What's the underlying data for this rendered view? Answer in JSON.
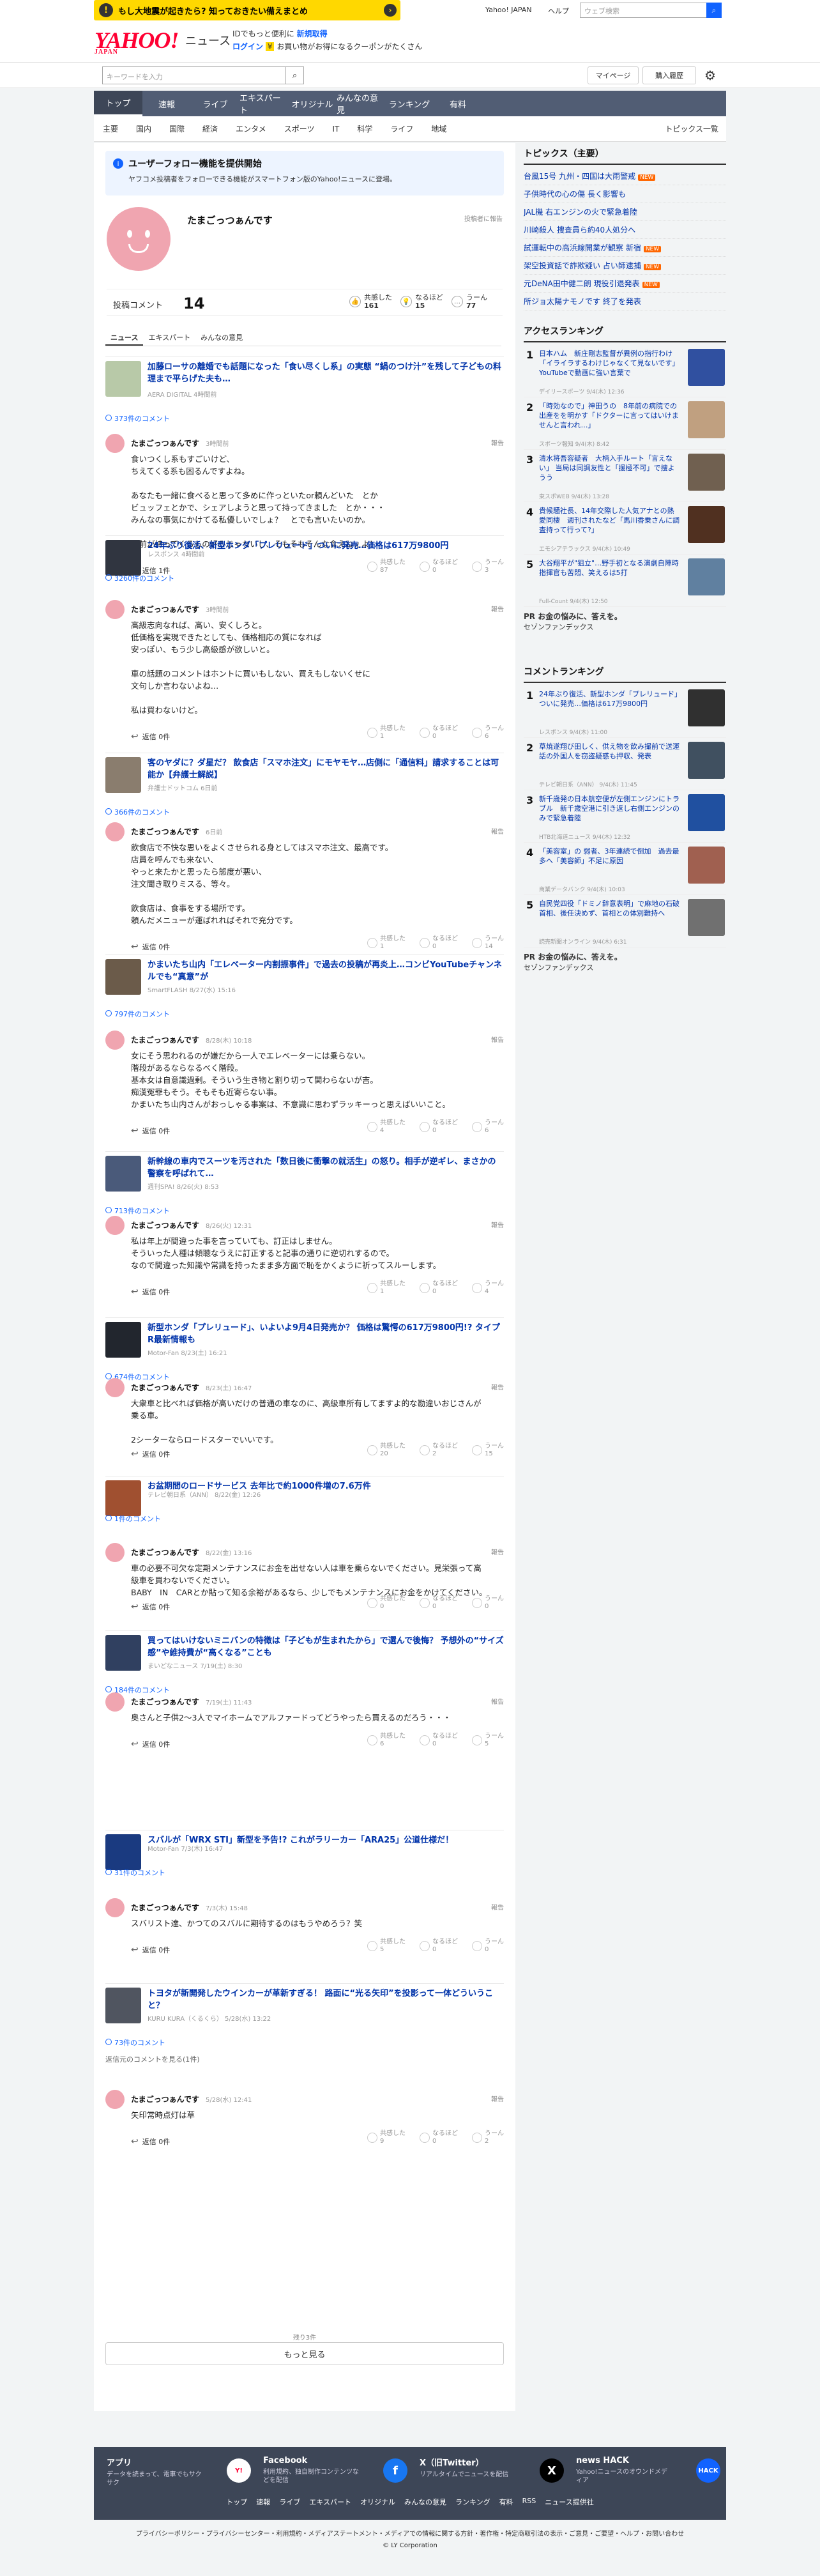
{
  "topbar": {
    "banner": "もし大地震が起きたら? 知っておきたい備えまとめ",
    "yjapan": "Yahoo! JAPAN",
    "help": "ヘルプ",
    "search_placeholder": "ウェブ検索",
    "search_btn": "🔍"
  },
  "header": {
    "logo": "YAHOO!",
    "logo_sub": "JAPAN",
    "brand": "ニュース",
    "id_text": "IDでもっと便利に",
    "id_link": "新規取得",
    "login": "ログイン",
    "coupon": "お買い物がお得になるクーポンがたくさん"
  },
  "subbar": {
    "keyword_placeholder": "キーワードを入力",
    "mypage": "マイページ",
    "purchased": "購入履歴"
  },
  "nav": [
    "トップ",
    "速報",
    "ライブ",
    "エキスパート",
    "オリジナル",
    "みんなの意見",
    "ランキング",
    "有料"
  ],
  "categories": [
    "主要",
    "国内",
    "国際",
    "経済",
    "エンタメ",
    "スポーツ",
    "IT",
    "科学",
    "ライフ",
    "地域"
  ],
  "all_topics": "トピックス一覧",
  "notice": {
    "title": "ユーザーフォロー機能を提供開始",
    "desc": "ヤフコメ投稿者をフォローできる機能がスマートフォン版のYahoo!ニュースに登場。"
  },
  "profile": {
    "name": "たまごっつぁんです",
    "report": "投稿者に報告",
    "posts_label": "投稿コメント",
    "posts": "14",
    "kyokan_label": "共感した",
    "kyokan": "161",
    "naruhodo_label": "なるほど",
    "naruhodo": "15",
    "uun_label": "うーん",
    "uun": "77"
  },
  "tabs": [
    "ニュース",
    "エキスパート",
    "みんなの意見"
  ],
  "articles": [
    {
      "title": "加藤ローサの離婚でも話題になった「食い尽くし系」の実態 “鍋のつけ汁”を残して子どもの料理まで平らげた夫も…",
      "src": "AERA DIGITAL 4時間前",
      "count": "373件のコメント",
      "date": "3時間前",
      "body": "食いつくし系もすごいけど、\nちえてくる系も困るんですよね。\n\nあなたも一緒に食べると思って多めに作っといたor頼んどいた　とか\nビュッフェとかで、シェアしようと思って持ってきました　とか・・・\nみんなの事気にかけてる私優しいでしょ？　とでも言いたいのか。\n\nお前が持ってくるもの好みじゃないし、そもそもそんな食えねぇよ！",
      "rep": "返信 1件",
      "k": "87",
      "n": "0",
      "u": "3"
    },
    {
      "title": "24年ぶり復活、新型ホンダ「プレリュード」ついに発売…価格は617万9800円",
      "src": "レスポンス 4時間前",
      "count": "3260件のコメント",
      "date": "3時間前",
      "body": "高級志向なれば、高い、安くしろと。\n低価格を実現できたとしても、価格相応の質になれば\n安っぽい、もう少し高級感が欲しいと。\n\n車の話題のコメントはホントに買いもしない、買えもしないくせに\n文句しか言わないよね…\n\n私は買わないけど。",
      "rep": "返信 0件",
      "k": "1",
      "n": "0",
      "u": "6"
    },
    {
      "title": "客のヤダに？ダ星だ？ 飲食店「スマホ注文」にモヤモヤ…店側に「通信料」請求することは可能か【弁護士解説】",
      "src": "弁護士ドットコム 6日前",
      "count": "366件のコメント",
      "date": "6日前",
      "body": "飲食店で不快な思いをよくさせられる身としてはスマホ注文、最高です。\n店員を呼んでも来ない、\nやっと来たかと思ったら態度が悪い、\n注文聞き取りミスる、等々。\n\n飲食店は、食事をする場所です。\n頼んだメニューが運ばれればそれで充分です。",
      "rep": "返信 0件",
      "k": "1",
      "n": "0",
      "u": "14"
    },
    {
      "title": "かまいたち山内「エレベーター内割振事件」で過去の投稿が再炎上…コンビYouTubeチャンネルでも“真意”が",
      "src": "SmartFLASH 8/27(水) 15:16",
      "count": "797件のコメント",
      "date": "8/28(木) 10:18",
      "body": "女にそう思われるのが嫌だから一人でエレベーターには乗らない。\n階段があるならなるべく階段。\n基本女は自意識過剰。そういう生き物と割り切って関わらないが吉。\n痴漢冤罪もそう。そもそも近寄らない事。\nかまいたち山内さんがおっしゃる事案は、不意識に思わずラッキーっと思えばいいこと。",
      "rep": "返信 0件",
      "k": "4",
      "n": "0",
      "u": "6"
    },
    {
      "title": "新幹線の車内でスーツを汚された「数日後に衝撃の就活生」の怒り。相手が逆ギレ、まさかの警察を呼ばれて…",
      "src": "週刊SPA! 8/26(火) 8:53",
      "count": "713件のコメント",
      "date": "8/26(火) 12:31",
      "body": "私は年上が間違った事を言っていても、訂正はしません。\nそういった人種は傾聴なうえに訂正すると記事の通りに逆切れするので。\nなので間違った知識や常識を持ったまま多方面で恥をかくように祈ってスルーします。",
      "rep": "返信 0件",
      "k": "1",
      "n": "0",
      "u": "4"
    },
    {
      "title": "新型ホンダ「プレリュード」、いよいよ9月4日発売か？ 価格は驚愕の617万9800円!? タイプR最新情報も",
      "src": "Motor-Fan 8/23(土) 16:21",
      "count": "674件のコメント",
      "date": "8/23(土) 16:47",
      "body": "大衆車と比べれば価格が高いだけの普通の車なのに、高級車所有してますよ的な勘違いおじさんが乗る車。\n\n2シーターならロードスターでいいです。",
      "rep": "返信 0件",
      "k": "20",
      "n": "2",
      "u": "15"
    },
    {
      "title": "お盆期間のロードサービス 去年比で約1000件増の7.6万件",
      "src": "テレビ朝日系（ANN） 8/22(金) 12:26",
      "count": "1件のコメント",
      "date": "8/22(金) 13:16",
      "body": "車の必要不可欠な定期メンテナンスにお金を出せない人は車を乗らないでください。見栄張って高級車を買わないでください。\nBABY　IN　CARとか貼って知る余裕があるなら、少しでもメンテナンスにお金をかけてください。",
      "rep": "返信 0件",
      "k": "0",
      "n": "0",
      "u": "0"
    },
    {
      "title": "買ってはいけないミニバンの特徴は「子どもが生まれたから」で選んで後悔？ 予想外の“サイズ感”や維持費が“高くなる”ことも",
      "src": "まいどなニュース 7/19(土) 8:30",
      "count": "184件のコメント",
      "date": "7/19(土) 11:43",
      "body": "奥さんと子供2〜3人でマイホームでアルファードってどうやったら買えるのだろう・・・",
      "rep": "返信 0件",
      "k": "6",
      "n": "0",
      "u": "5"
    },
    {
      "title": "スバルが「WRX STI」新型を予告!? これがラリーカー「ARA25」公道仕様だ！",
      "src": "Motor-Fan 7/3(木) 16:47",
      "count": "31件のコメント",
      "date": "7/3(木) 15:48",
      "body": "スバリスト達、かつてのスバルに期待するのはもうやめろう？笑",
      "rep": "返信 0件",
      "k": "5",
      "n": "0",
      "u": "0"
    },
    {
      "title": "トヨタが新開発したウインカーが革新すぎる！ 路面に“光る矢印”を投影って一体どういうこと？",
      "src": "KURU KURA（くるくら） 5/28(水) 13:22",
      "count": "73件のコメント",
      "date": "5/28(水) 12:41",
      "deleted": "返信元のコメントを見る(1件)",
      "body": "矢印常時点灯は草",
      "rep": "返信 0件",
      "k": "9",
      "n": "0",
      "u": "2"
    }
  ],
  "all_count": "残り3件",
  "more": "もっと見る",
  "side": {
    "topics_title": "トピックス（主要）",
    "topics": [
      {
        "t": "台風15号 九州・四国は大雨警戒",
        "b": "NEW"
      },
      {
        "t": "子供時代の心の傷 長く影響も",
        "b": ""
      },
      {
        "t": "JAL機 右エンジンの火で緊急着陸",
        "b": ""
      },
      {
        "t": "川崎殺人 捜査員ら約40人処分へ",
        "b": ""
      },
      {
        "t": "試運転中の高浜線開業が観察 新宿",
        "b": "NEW"
      },
      {
        "t": "架空投資話で詐欺疑い 占い師逮捕",
        "b": "NEW"
      },
      {
        "t": "元DeNA田中健二朗 現役引退発表",
        "b": "NEW"
      },
      {
        "t": "所ジョ太陽ナモノです 終了を発表",
        "b": ""
      }
    ],
    "access_title": "アクセスランキング",
    "access": [
      {
        "t": "日本ハム　新庄剛志監督が異例の指行わけ「イライラするわけじゃなくて見ないです」YouTubeで動画に強い言葉で",
        "s": "デイリースポーツ 9/4(木) 12:36"
      },
      {
        "t": "「時効なので」神田うの　8年前の病院での出産をを明かす「ドクターに言ってはいけませんと言われ…」",
        "s": "スポーツ報知 9/4(木) 8:42"
      },
      {
        "t": "清水将吾容疑者　大柄入手ルート「言えない」 当局は同調友性と「援極不可」で捜ようう",
        "s": "東スポWEB 9/4(木) 13:28"
      },
      {
        "t": "貴候騒社長、14年交際した人気アナとの熱愛同棲　週刊されたなど「馬川香乗さんに調査持って行って?」",
        "s": "エモシアテラックス 9/4(木) 10:49"
      },
      {
        "t": "大谷翔平が\"狙立\"…野手初となる演劇自陣時　指揮官も苦悶、笑えるは5打",
        "s": "Full-Count 9/4(木) 12:50"
      }
    ],
    "pr1": "PR お金の悩みに、答えを。",
    "pr1s": "セゾンファンデックス",
    "comment_title": "コメントランキング",
    "comments": [
      {
        "t": "24年ぶり復活、新型ホンダ「プレリュード」ついに発売…価格は617万9800円",
        "s": "レスポンス 9/4(木) 11:00"
      },
      {
        "t": "草焼遂翔び田しく、供え物を飲み撮前で送運話の外国人を窃盗疑惑も押収、発表",
        "s": "テレビ朝日系（ANN） 9/4(木) 11:45"
      },
      {
        "t": "新千歳発の日本航空便が左側エンジンにトラブル　新千歳空港に引き返し右側エンジンのみで緊急着陸",
        "s": "HTB北海道ニュース 9/4(木) 12:32"
      },
      {
        "t": "「美容室」の 弱者、3年連続で倒加　過去最多へ「美容師」不足に原因",
        "s": "商業データバンク 9/4(木) 10:03"
      },
      {
        "t": "自民党四役「ドミノ辞意表明」で麻地の石破首相、後任決めず、首相との体別難持へ",
        "s": "読売新聞オンライン 9/4(木) 6:31"
      }
    ],
    "pr2": "PR お金の悩みに、答えを。",
    "pr2s": "セゾンファンデックス"
  },
  "footer": {
    "cols": [
      {
        "h": "アプリ",
        "d": "データを読まって、電車でもサクサク"
      },
      {
        "h": "Facebook",
        "d": "利用規約、独自制作コンテンツなどを配信"
      },
      {
        "h": "X（旧Twitter）",
        "d": "リアルタイムでニュースを配信"
      },
      {
        "h": "news HACK",
        "d": "Yahoo!ニュースのオウンドメディア"
      }
    ],
    "links": [
      "トップ",
      "速報",
      "ライブ",
      "エキスパート",
      "オリジナル",
      "みんなの意見",
      "ランキング",
      "有料",
      "RSS",
      "ニュース提供社"
    ],
    "legal1": "プライバシーポリシー・プライバシーセンター・利用規約・メディアステートメント・メディアでの情報に関する方針・著作権・特定商取引法の表示・ご意見・ご要望・ヘルプ・お問い合わせ",
    "legal2": "© LY Corporation"
  }
}
